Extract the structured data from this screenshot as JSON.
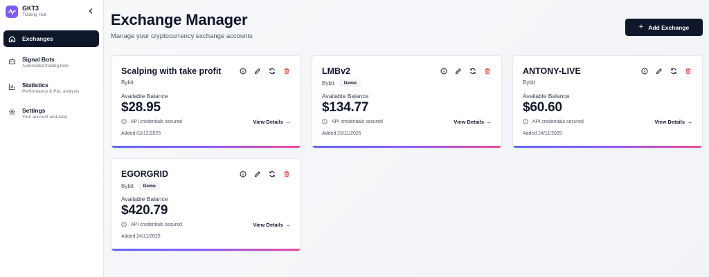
{
  "brand": {
    "name": "GKT3",
    "subtitle": "Trading Hub"
  },
  "nav": [
    {
      "label": "Exchanges",
      "sub": "",
      "icon": "home-icon",
      "active": true
    },
    {
      "label": "Signal Bots",
      "sub": "Automated trading bots",
      "icon": "bot-icon"
    },
    {
      "label": "Statistics",
      "sub": "Performance & P&L analysis",
      "icon": "bar-chart-icon"
    },
    {
      "label": "Settings",
      "sub": "Your account and data",
      "icon": "gear-icon"
    }
  ],
  "header": {
    "title": "Exchange Manager",
    "subtitle": "Manage your cryptocurrency exchange accounts",
    "add_label": "Add Exchange"
  },
  "labels": {
    "available_balance": "Available Balance",
    "secured": "API credentials secured",
    "view_details": "View Details",
    "demo": "Demo"
  },
  "cards": [
    {
      "name": "Scalping with take profit",
      "provider": "Bybit",
      "demo": false,
      "balance": "$28.95",
      "added": "Added 02/12/2025"
    },
    {
      "name": "LMBv2",
      "provider": "Bybit",
      "demo": true,
      "balance": "$134.77",
      "added": "Added 25/11/2025"
    },
    {
      "name": "ANTONY-LIVE",
      "provider": "Bybit",
      "demo": false,
      "balance": "$60.60",
      "added": "Added 24/11/2025"
    },
    {
      "name": "EGORGRID",
      "provider": "Bybit",
      "demo": true,
      "balance": "$420.79",
      "added": "Added 24/11/2025"
    }
  ],
  "colors": {
    "accent_dark": "#0f172a",
    "delete_red": "#ef4444",
    "gradient": [
      "#6366f1",
      "#8b5cf6",
      "#ec4899"
    ]
  }
}
